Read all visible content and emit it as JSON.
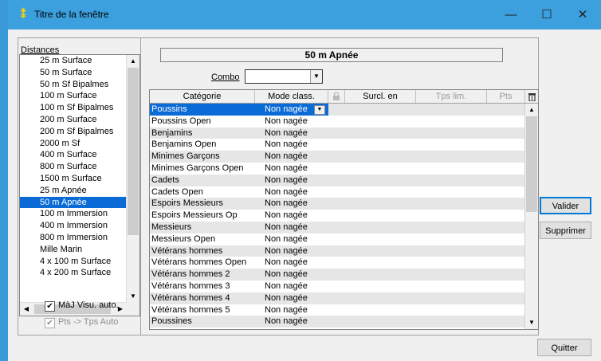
{
  "window": {
    "title": "Titre de la fenêtre",
    "icon": "app-icon",
    "minimize": "—",
    "maximize": "☐",
    "close": "✕"
  },
  "left": {
    "distances_label": "Distances",
    "distances": [
      "25 m Surface",
      "50 m Surface",
      "50 m Sf Bipalmes",
      "100 m Surface",
      "100 m Sf Bipalmes",
      "200 m Surface",
      "200 m Sf Bipalmes",
      "2000 m Sf",
      "400 m Surface",
      "800 m Surface",
      "1500 m Surface",
      "25 m Apnée",
      "50 m Apnée",
      "100 m Immersion",
      "400 m Immersion",
      "800 m Immersion",
      "Mille Marin",
      "4 x 100 m Surface",
      "4 x 200 m Surface"
    ],
    "selected_index": 12,
    "maj_visu_label": "MàJ Visu. auto.",
    "maj_visu_checked": true,
    "pts_tps_label": "Pts -> Tps Auto",
    "pts_tps_checked": true
  },
  "main": {
    "heading": "50 m Apnée",
    "combo_label": "Combo",
    "combo_value": "",
    "columns": [
      "Catégorie",
      "Mode class.",
      "Surcl. en",
      "Tps lim.",
      "Pts"
    ],
    "rows": [
      {
        "cat": "Poussins",
        "mode": "Non nagée"
      },
      {
        "cat": "Poussins Open",
        "mode": "Non nagée"
      },
      {
        "cat": "Benjamins",
        "mode": "Non nagée"
      },
      {
        "cat": "Benjamins Open",
        "mode": "Non nagée"
      },
      {
        "cat": "Minimes Garçons",
        "mode": "Non nagée"
      },
      {
        "cat": "Minimes Garçons Open",
        "mode": "Non nagée"
      },
      {
        "cat": "Cadets",
        "mode": "Non nagée"
      },
      {
        "cat": "Cadets Open",
        "mode": "Non nagée"
      },
      {
        "cat": "Espoirs Messieurs",
        "mode": "Non nagée"
      },
      {
        "cat": "Espoirs Messieurs Op",
        "mode": "Non nagée"
      },
      {
        "cat": "Messieurs",
        "mode": "Non nagée"
      },
      {
        "cat": "Messieurs Open",
        "mode": "Non nagée"
      },
      {
        "cat": "Vétérans hommes",
        "mode": "Non nagée"
      },
      {
        "cat": "Vétérans hommes Open",
        "mode": "Non nagée"
      },
      {
        "cat": "Vétérans hommes 2",
        "mode": "Non nagée"
      },
      {
        "cat": "Vétérans hommes 3",
        "mode": "Non nagée"
      },
      {
        "cat": "Vétérans hommes 4",
        "mode": "Non nagée"
      },
      {
        "cat": "Vétérans hommes 5",
        "mode": "Non nagée"
      },
      {
        "cat": "Poussines",
        "mode": "Non nagée"
      }
    ],
    "selected_row": 0
  },
  "buttons": {
    "valider": "Valider",
    "supprimer": "Supprimer",
    "quitter": "Quitter"
  },
  "colors": {
    "titlebar": "#3ba0dd",
    "selection": "#0a6ad6",
    "window_bg": "#f0f0f0"
  }
}
